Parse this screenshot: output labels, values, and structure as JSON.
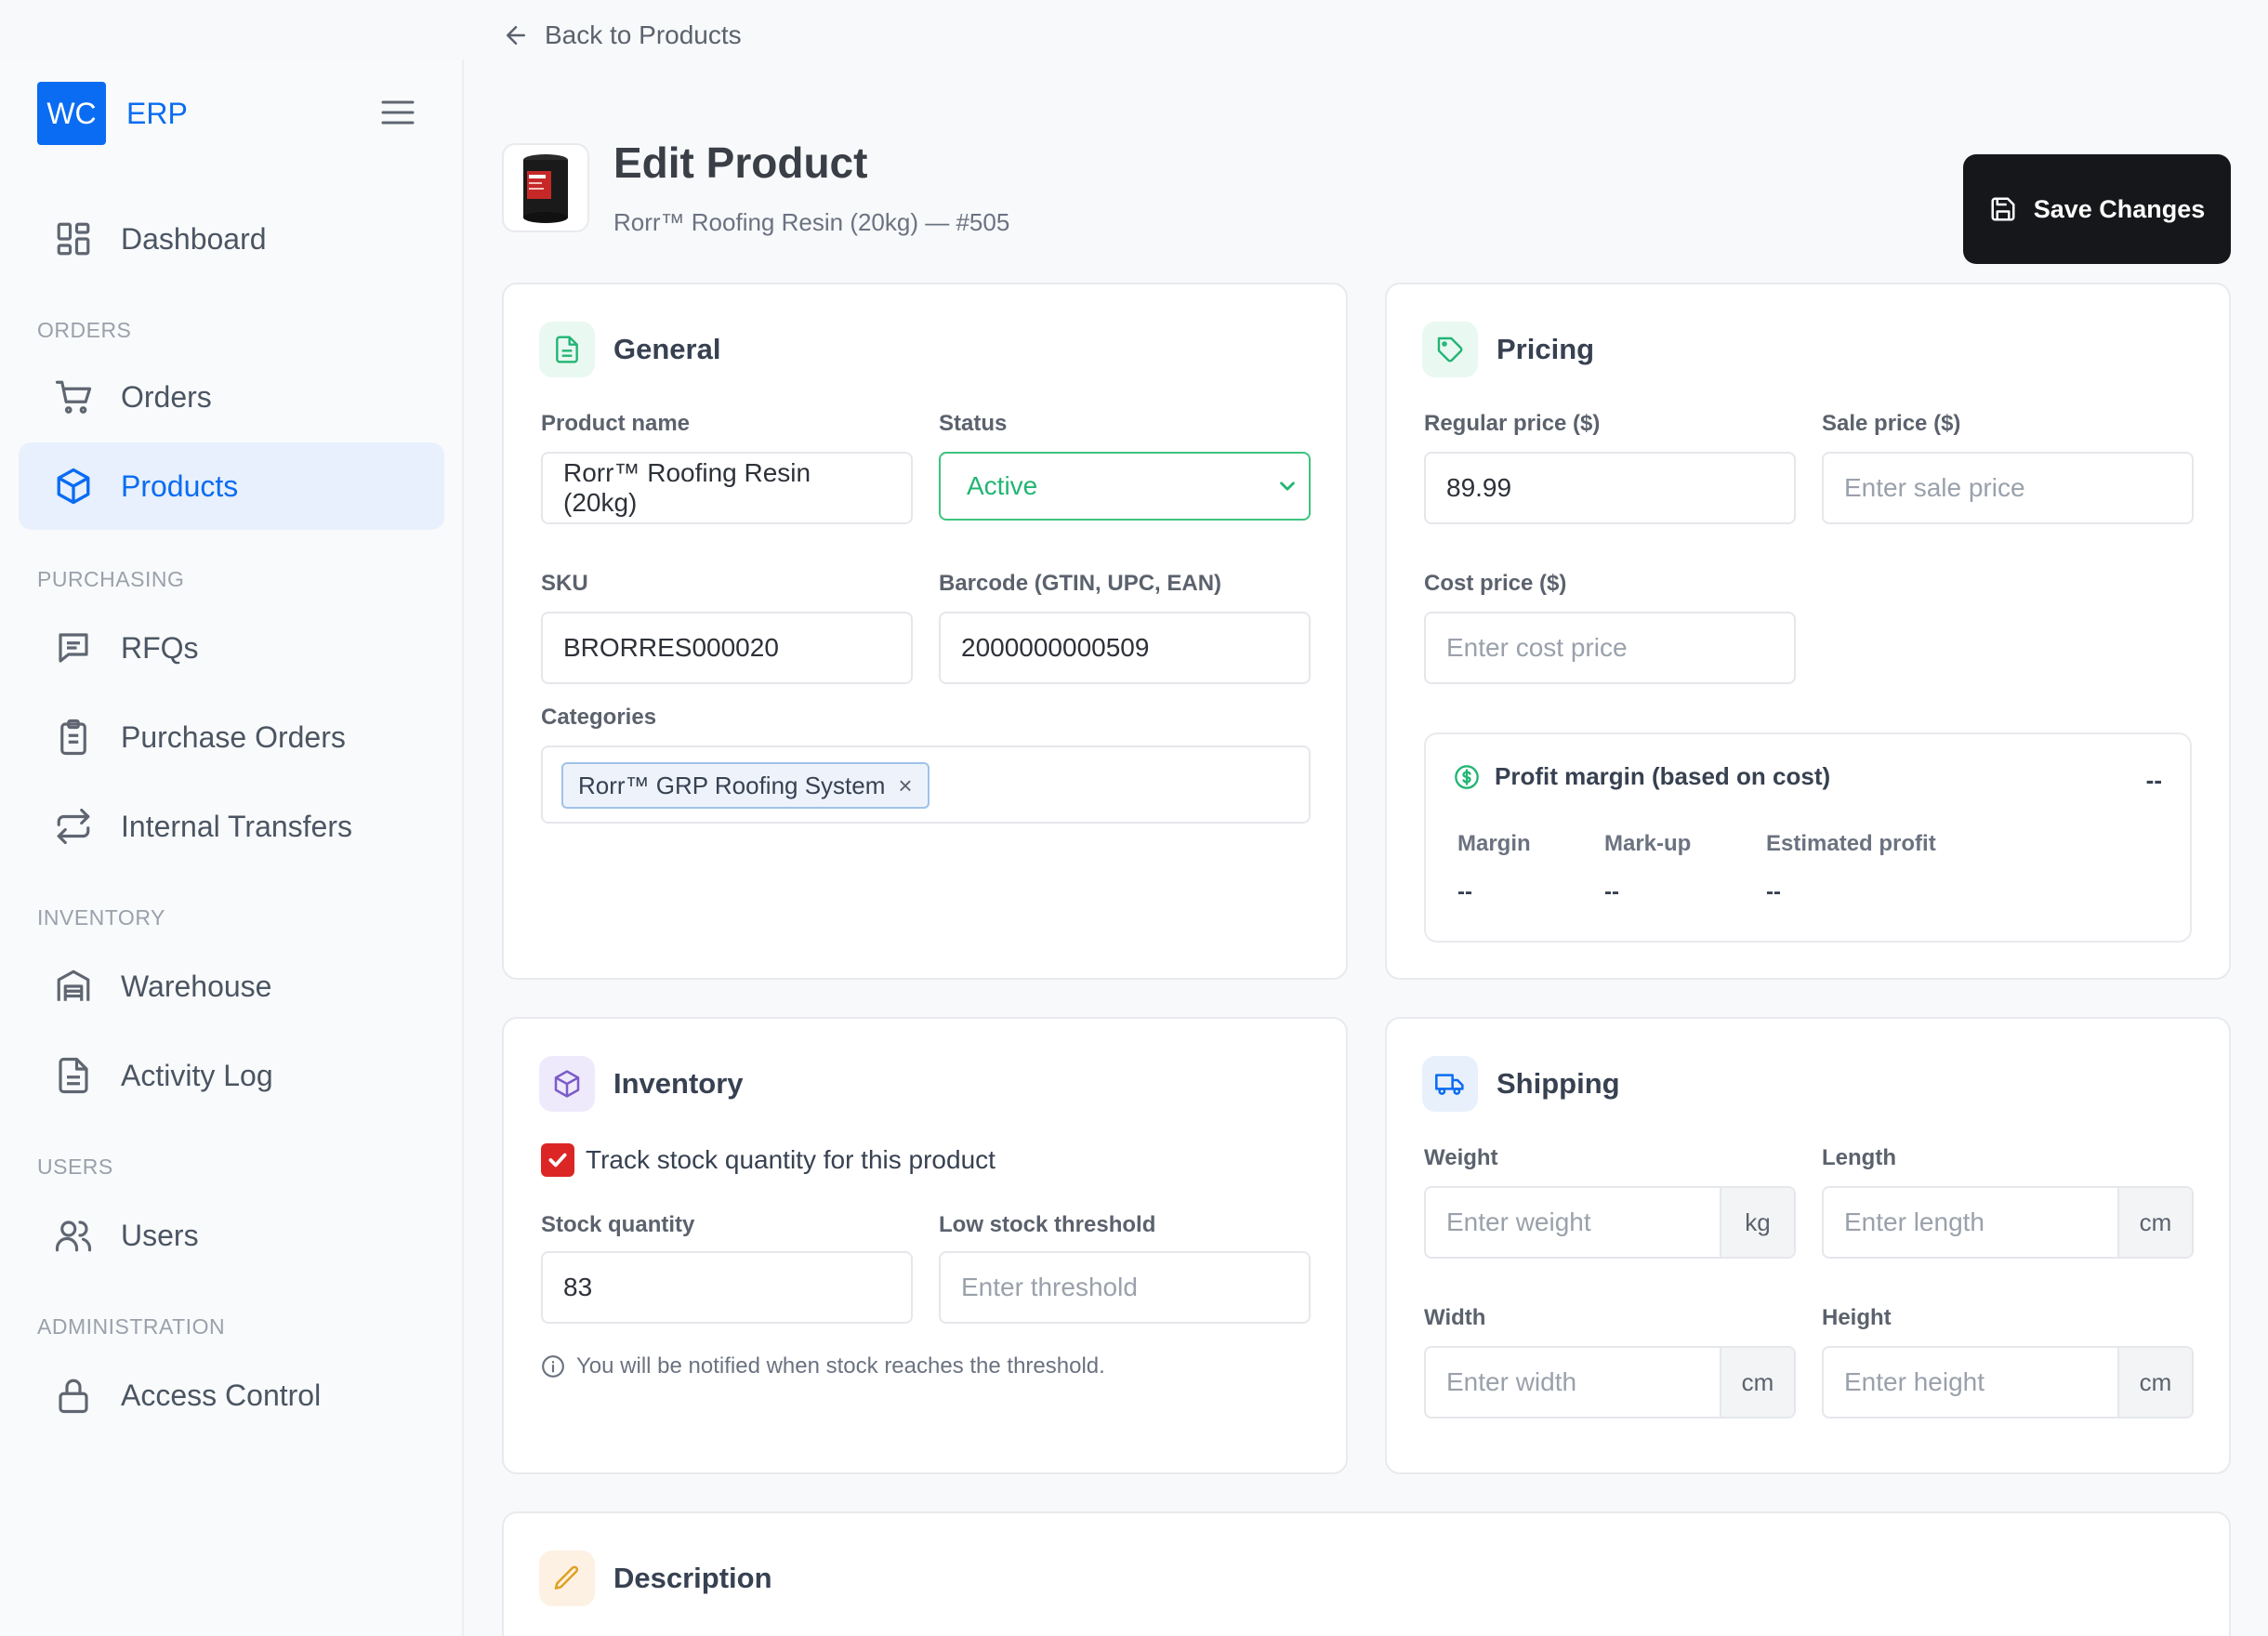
{
  "header": {
    "back_label": "Back to Products",
    "title": "Edit Product",
    "subtitle": "Rorr™ Roofing Resin (20kg) — #505",
    "save_label": "Save Changes"
  },
  "brand": {
    "logo": "WC",
    "name": "ERP"
  },
  "sidebar": {
    "dashboard": "Dashboard",
    "sections": {
      "orders": "ORDERS",
      "purchasing": "PURCHASING",
      "inventory": "INVENTORY",
      "users": "USERS",
      "administration": "ADMINISTRATION"
    },
    "items": {
      "orders": "Orders",
      "products": "Products",
      "rfqs": "RFQs",
      "purchase_orders": "Purchase Orders",
      "internal_transfers": "Internal Transfers",
      "warehouse": "Warehouse",
      "activity_log": "Activity Log",
      "users": "Users",
      "access_control": "Access Control"
    },
    "active_item": "Products"
  },
  "general": {
    "title": "General",
    "product_name_label": "Product name",
    "product_name_value": "Rorr™ Roofing Resin (20kg)",
    "status_label": "Status",
    "status_value": "Active",
    "sku_label": "SKU",
    "sku_value": "BRORRES000020",
    "barcode_label": "Barcode (GTIN, UPC, EAN)",
    "barcode_value": "2000000000509",
    "categories_label": "Categories",
    "categories": [
      "Rorr™ GRP Roofing System"
    ],
    "tag_remove": "×"
  },
  "pricing": {
    "title": "Pricing",
    "regular_label": "Regular price ($)",
    "regular_value": "89.99",
    "sale_label": "Sale price ($)",
    "sale_placeholder": "Enter sale price",
    "cost_label": "Cost price ($)",
    "cost_placeholder": "Enter cost price",
    "margin_title": "Profit margin (based on cost)",
    "margin_summary": "--",
    "margin_label": "Margin",
    "margin_value": "--",
    "markup_label": "Mark-up",
    "markup_value": "--",
    "profit_label": "Estimated profit",
    "profit_value": "--"
  },
  "inventory": {
    "title": "Inventory",
    "track_label": "Track stock quantity for this product",
    "track_checked": true,
    "stock_label": "Stock quantity",
    "stock_value": "83",
    "threshold_label": "Low stock threshold",
    "threshold_placeholder": "Enter threshold",
    "hint": "You will be notified when stock reaches the threshold."
  },
  "shipping": {
    "title": "Shipping",
    "weight_label": "Weight",
    "weight_placeholder": "Enter weight",
    "weight_unit": "kg",
    "length_label": "Length",
    "length_placeholder": "Enter length",
    "length_unit": "cm",
    "width_label": "Width",
    "width_placeholder": "Enter width",
    "width_unit": "cm",
    "height_label": "Height",
    "height_placeholder": "Enter height",
    "height_unit": "cm"
  },
  "description": {
    "title": "Description"
  },
  "colors": {
    "accent": "#0a6cf2",
    "status_green": "#22b573",
    "checkbox_red": "#dc2626",
    "save_button": "#16171a"
  }
}
